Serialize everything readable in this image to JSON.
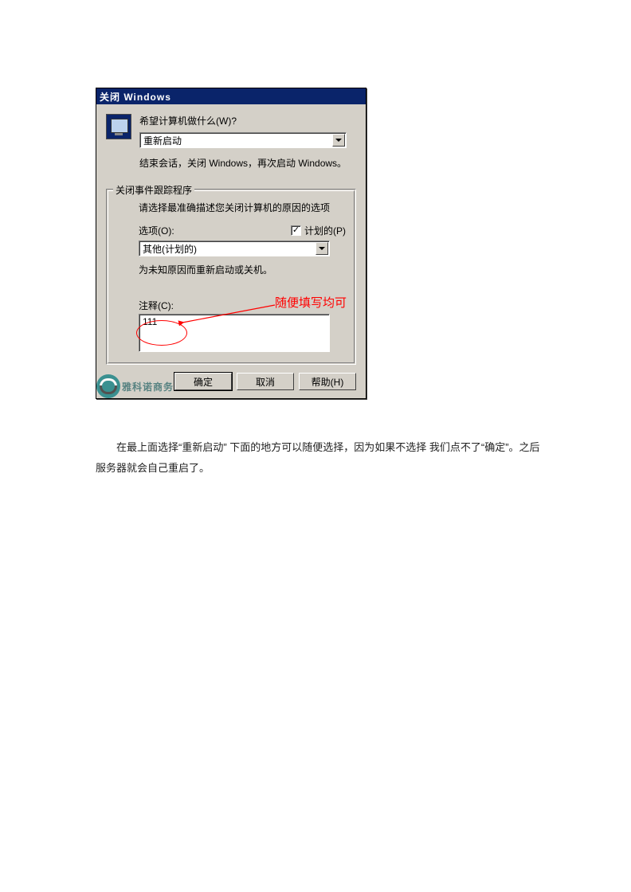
{
  "dialog": {
    "title": "关闭 Windows",
    "prompt": "希望计算机做什么(W)?",
    "action_select": "重新启动",
    "action_desc": "结束会话，关闭 Windows，再次启动 Windows。",
    "group": {
      "title": "关闭事件跟踪程序",
      "subtitle": "请选择最准确描述您关闭计算机的原因的选项",
      "option_label": "选项(O):",
      "planned_label": "计划的(P)",
      "planned_checked": "✓",
      "reason_select": "其他(计划的)",
      "reason_desc": "为未知原因而重新启动或关机。",
      "comment_label": "注释(C):",
      "comment_value": "111"
    },
    "buttons": {
      "ok": "确定",
      "cancel": "取消",
      "help": "帮助(H)"
    }
  },
  "annotation": {
    "text": "随便填写均可"
  },
  "watermark": "雅科诺商务",
  "caption": "在最上面选择“重新启动”  下面的地方可以随便选择，因为如果不选择 我们点不了“确定”。之后服务器就会自己重启了。"
}
